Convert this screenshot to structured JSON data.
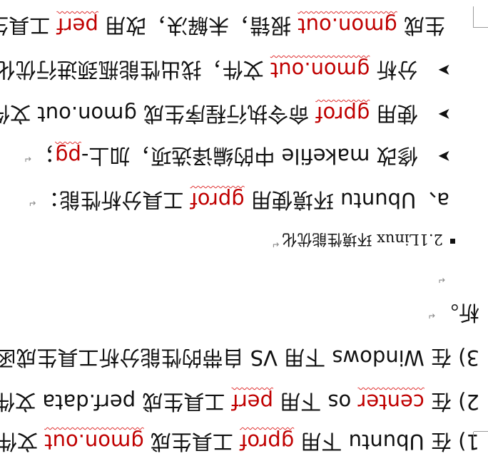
{
  "lines": [
    {
      "prefix": "1) 在 Ubuntu 下用 ",
      "term1": "gprof",
      "mid": " 工具生成 ",
      "term2": "gmon.out",
      "suffix": " 文件"
    },
    {
      "prefix": "2) 在 ",
      "term1": "center",
      "mid": " os 下用 ",
      "term2": "perf",
      "suffix": " 工具生成 perf.data 文件"
    },
    {
      "text": "3) 在 Windows 下用 VS 自带的性能分析工具生成函"
    },
    {
      "text": "析。"
    },
    {
      "text": ""
    },
    {
      "heading": "2.1Linux 环境性能优化"
    },
    {
      "prefix": "a、Ubuntu 环境使用 ",
      "term1": "gprof",
      "suffix": " 工具分析性能："
    },
    {
      "prefix": "修改 makefile 中的编译选项，加上-",
      "term1": "pg",
      "suffix": "；"
    },
    {
      "prefix": "使用 ",
      "term1": "gprof",
      "suffix": " 命令执行程序生成 gmon.out 文件；"
    },
    {
      "prefix": "分析 ",
      "term1": "gmon.out",
      "suffix": " 文件，找出性能瓶颈进行优化。"
    },
    {
      "prefix": "生成 ",
      "term1": "gmon.out",
      "mid": " 报错，未解决，改用 ",
      "term2": "perf",
      "suffix": " 工具生成"
    }
  ],
  "symbols": {
    "arrow": "➤",
    "paragraph_mark": "↵"
  }
}
